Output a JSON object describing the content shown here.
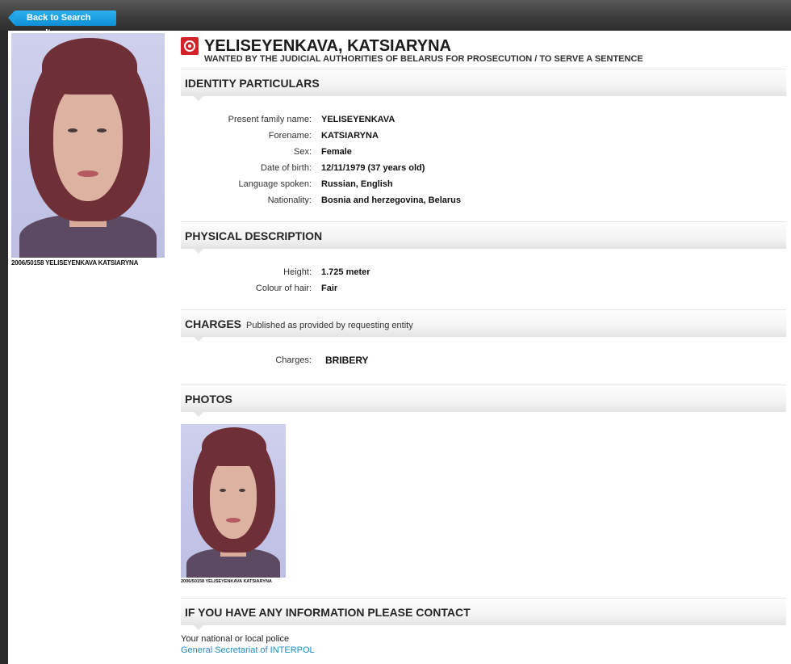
{
  "nav": {
    "back_label": "Back to Search result"
  },
  "profile": {
    "name": "YELISEYENKAVA, KATSIARYNA",
    "subtitle": "WANTED BY THE JUDICIAL AUTHORITIES OF BELARUS FOR PROSECUTION / TO SERVE A SENTENCE",
    "photo_caption": "2006/50158 YELISEYENKAVA KATSIARYNA"
  },
  "identity": {
    "heading": "IDENTITY PARTICULARS",
    "fields": [
      {
        "label": "Present family name:",
        "value": "YELISEYENKAVA"
      },
      {
        "label": "Forename:",
        "value": "KATSIARYNA"
      },
      {
        "label": "Sex:",
        "value": "Female"
      },
      {
        "label": "Date of birth:",
        "value": "12/11/1979 (37 years old)"
      },
      {
        "label": "Language spoken:",
        "value": "Russian, English"
      },
      {
        "label": "Nationality:",
        "value": "Bosnia and herzegovina, Belarus"
      }
    ]
  },
  "physical": {
    "heading": "PHYSICAL DESCRIPTION",
    "fields": [
      {
        "label": "Height:",
        "value": "1.725 meter"
      },
      {
        "label": "Colour of hair:",
        "value": "Fair"
      }
    ]
  },
  "charges": {
    "heading": "CHARGES",
    "note": "Published as provided by requesting entity",
    "label": "Charges:",
    "value": "BRIBERY"
  },
  "photos": {
    "heading": "PHOTOS",
    "caption": "2006/50158 YELISEYENKAVA KATSIARYNA"
  },
  "contact": {
    "heading": "IF YOU HAVE ANY INFORMATION PLEASE CONTACT",
    "line1": "Your national or local police",
    "link": "General Secretariat of INTERPOL"
  },
  "colors": {
    "accent": "#1ea2e5",
    "emblem": "#d3232a",
    "link": "#1f8ec4"
  }
}
